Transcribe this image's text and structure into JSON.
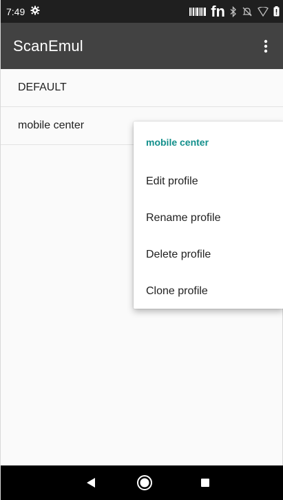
{
  "status_bar": {
    "time": "7:49",
    "icons": [
      "gear-icon",
      "barcode-icon",
      "fn-icon",
      "bluetooth-icon",
      "notifications-off-icon",
      "wifi-icon",
      "battery-icon"
    ],
    "fn_label": "fn"
  },
  "app_bar": {
    "title": "ScanEmul",
    "overflow_icon": "more-vert-icon"
  },
  "profiles": [
    {
      "label": "DEFAULT"
    },
    {
      "label": "mobile center"
    }
  ],
  "context_menu": {
    "title": "mobile center",
    "items": [
      {
        "label": "Edit profile"
      },
      {
        "label": "Rename profile"
      },
      {
        "label": "Delete profile"
      },
      {
        "label": "Clone profile"
      }
    ]
  },
  "nav_bar": {
    "buttons": [
      "back-icon",
      "home-icon",
      "recents-icon"
    ]
  },
  "colors": {
    "status_bar": "#1f1f1f",
    "app_bar": "#424242",
    "menu_accent": "#128f8b",
    "nav_bar": "#000000"
  }
}
